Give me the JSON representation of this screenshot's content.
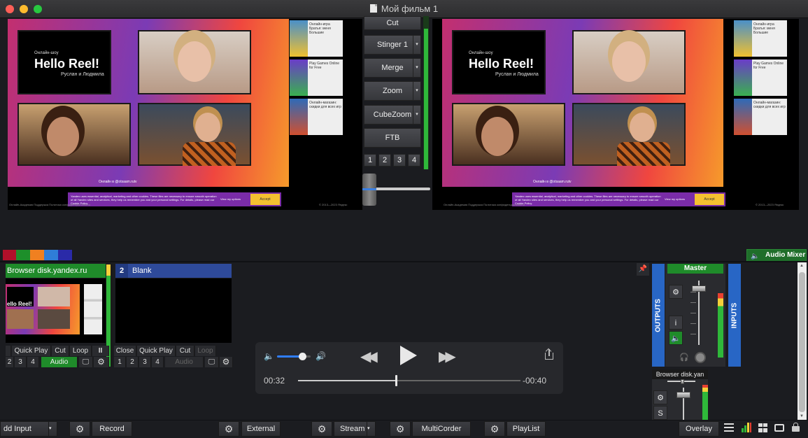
{
  "window": {
    "title": "Мой фильм 1"
  },
  "preview_screen": {
    "hello_small": "Онлайн-шоу",
    "hello_title": "Hello Reel!",
    "hello_sub": "Руслан и Людмила",
    "handle": "Онлайн в @otsaam.rutv",
    "thumbs": [
      {
        "text": "Онлайн-игра Братья: меня Большие"
      },
      {
        "text": "Play Games Online for Free"
      },
      {
        "text": "Онлайн-магазин: скидки для всех игр"
      }
    ],
    "cookie_text": "Yandex uses essential, analytical, marketing and other cookies. These files are necessary to ensure smooth operation of all Yandex sites and services, they help us remember you and your personal settings. For details, please read our Cookie Policy.",
    "cookie_more": "View my options",
    "cookie_accept": "Accept",
    "footer_left": "Онлайн-Академия   Поддержка   Политика конфиденциальности",
    "footer_right": "© 2013—2023 Яндекс"
  },
  "transitions": {
    "buttons": [
      {
        "label": "Cut",
        "dropdown": false
      },
      {
        "label": "Stinger 1",
        "dropdown": true
      },
      {
        "label": "Merge",
        "dropdown": true
      },
      {
        "label": "Zoom",
        "dropdown": true
      },
      {
        "label": "CubeZoom",
        "dropdown": true
      },
      {
        "label": "FTB",
        "dropdown": false
      }
    ],
    "numbers": [
      "1",
      "2",
      "3",
      "4"
    ],
    "dropdown_glyph": "▾",
    "level": 0.92
  },
  "swatch_colors": [
    "#b0102a",
    "#1d8f2a",
    "#f08020",
    "#2f7dd8",
    "#2a2aa8"
  ],
  "audio_mixer_label": "Audio Mixer",
  "input1": {
    "title": "Browser disk.yandex.ru",
    "mini_title": "ello Reel!",
    "controls": [
      "Quick Play",
      "Cut",
      "Loop",
      "II"
    ],
    "numbers": [
      "2",
      "3",
      "4"
    ],
    "audio": "Audio"
  },
  "input2": {
    "number": "2",
    "title": "Blank",
    "controls": [
      "Close",
      "Quick Play",
      "Cut",
      "Loop"
    ],
    "numbers": [
      "1",
      "2",
      "3",
      "4"
    ],
    "audio": "Audio"
  },
  "player": {
    "volume": 0.75,
    "current": "00:32",
    "remaining": "-00:40",
    "progress": 0.44
  },
  "audio_panel": {
    "outputs": "OUTPUTS",
    "inputs": "INPUTS",
    "master": "Master",
    "info_btn": "i",
    "browser": "Browser disk.yan",
    "solo": "S",
    "master_level": 0.78,
    "browser_level": 0.9
  },
  "toolbar": {
    "add_input": "dd Input",
    "record": "Record",
    "external": "External",
    "stream": "Stream",
    "multicorder": "MultiCorder",
    "playlist": "PlayList",
    "overlay": "Overlay",
    "dropdown_glyph": "▾"
  },
  "glyphs": {
    "gear": "⚙",
    "speaker": "🔈",
    "monitor": "🖵",
    "pin": "📌",
    "headphones": "🎧",
    "vol_low": "🔈",
    "vol_high": "🔊",
    "rewind": "◀◀",
    "forward": "▶▶",
    "scroll_up": "▲",
    "scroll_down": "▼"
  }
}
